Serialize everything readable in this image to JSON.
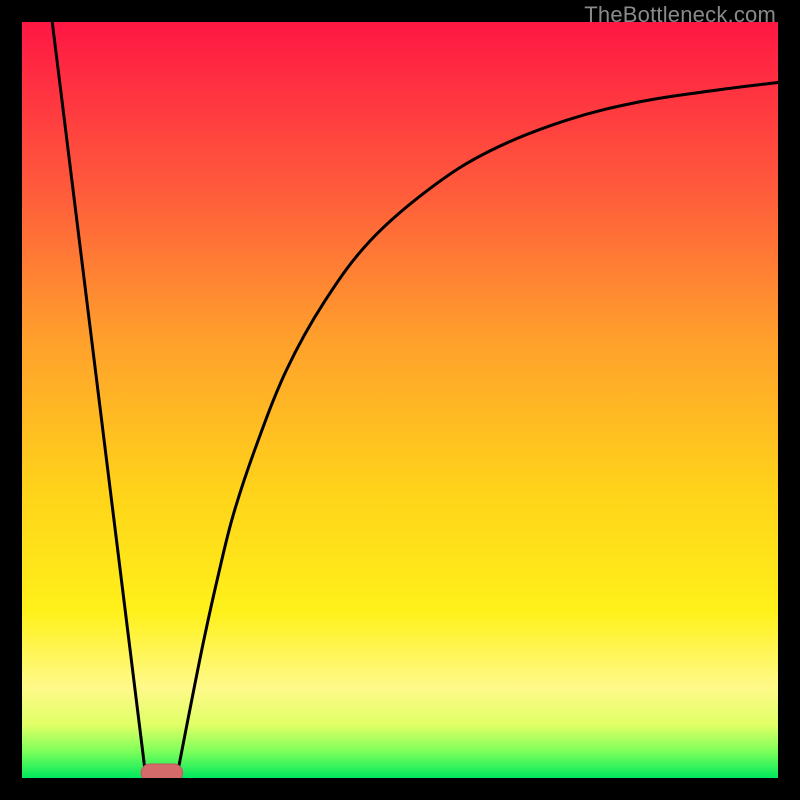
{
  "watermark": "TheBottleneck.com",
  "colors": {
    "black": "#000000",
    "curve": "#000000",
    "marker": "#d46a6a"
  },
  "chart_data": {
    "type": "line",
    "title": "",
    "xlabel": "",
    "ylabel": "",
    "xlim": [
      0,
      100
    ],
    "ylim": [
      0,
      100
    ],
    "grid": false,
    "legend": false,
    "note": "No tick labels, axis labels, or data labels are rendered. Values are estimated from plot geometry against a 0–100 normalized coordinate space.",
    "gradient_stops": [
      {
        "offset": 0.0,
        "color": "#ff1744"
      },
      {
        "offset": 0.22,
        "color": "#ff5a3c"
      },
      {
        "offset": 0.42,
        "color": "#ffa02c"
      },
      {
        "offset": 0.62,
        "color": "#ffd31a"
      },
      {
        "offset": 0.78,
        "color": "#fff11a"
      },
      {
        "offset": 0.88,
        "color": "#fff98a"
      },
      {
        "offset": 0.93,
        "color": "#e0ff66"
      },
      {
        "offset": 0.965,
        "color": "#7dff5a"
      },
      {
        "offset": 1.0,
        "color": "#00e85e"
      }
    ],
    "series": [
      {
        "name": "left-line",
        "x": [
          4.0,
          16.3
        ],
        "y": [
          100.0,
          0.8
        ]
      },
      {
        "name": "right-curve",
        "x": [
          20.6,
          22,
          24,
          26,
          28,
          31,
          35,
          40,
          46,
          54,
          62,
          72,
          82,
          92,
          100
        ],
        "y": [
          0.8,
          8,
          18,
          27,
          35,
          44,
          54,
          63,
          71,
          78,
          83,
          87,
          89.5,
          91,
          92
        ]
      }
    ],
    "marker": {
      "name": "bottom-marker",
      "shape": "rounded-rect",
      "x_center": 18.5,
      "y": 0.7,
      "width": 5.5,
      "height": 2.3
    }
  }
}
